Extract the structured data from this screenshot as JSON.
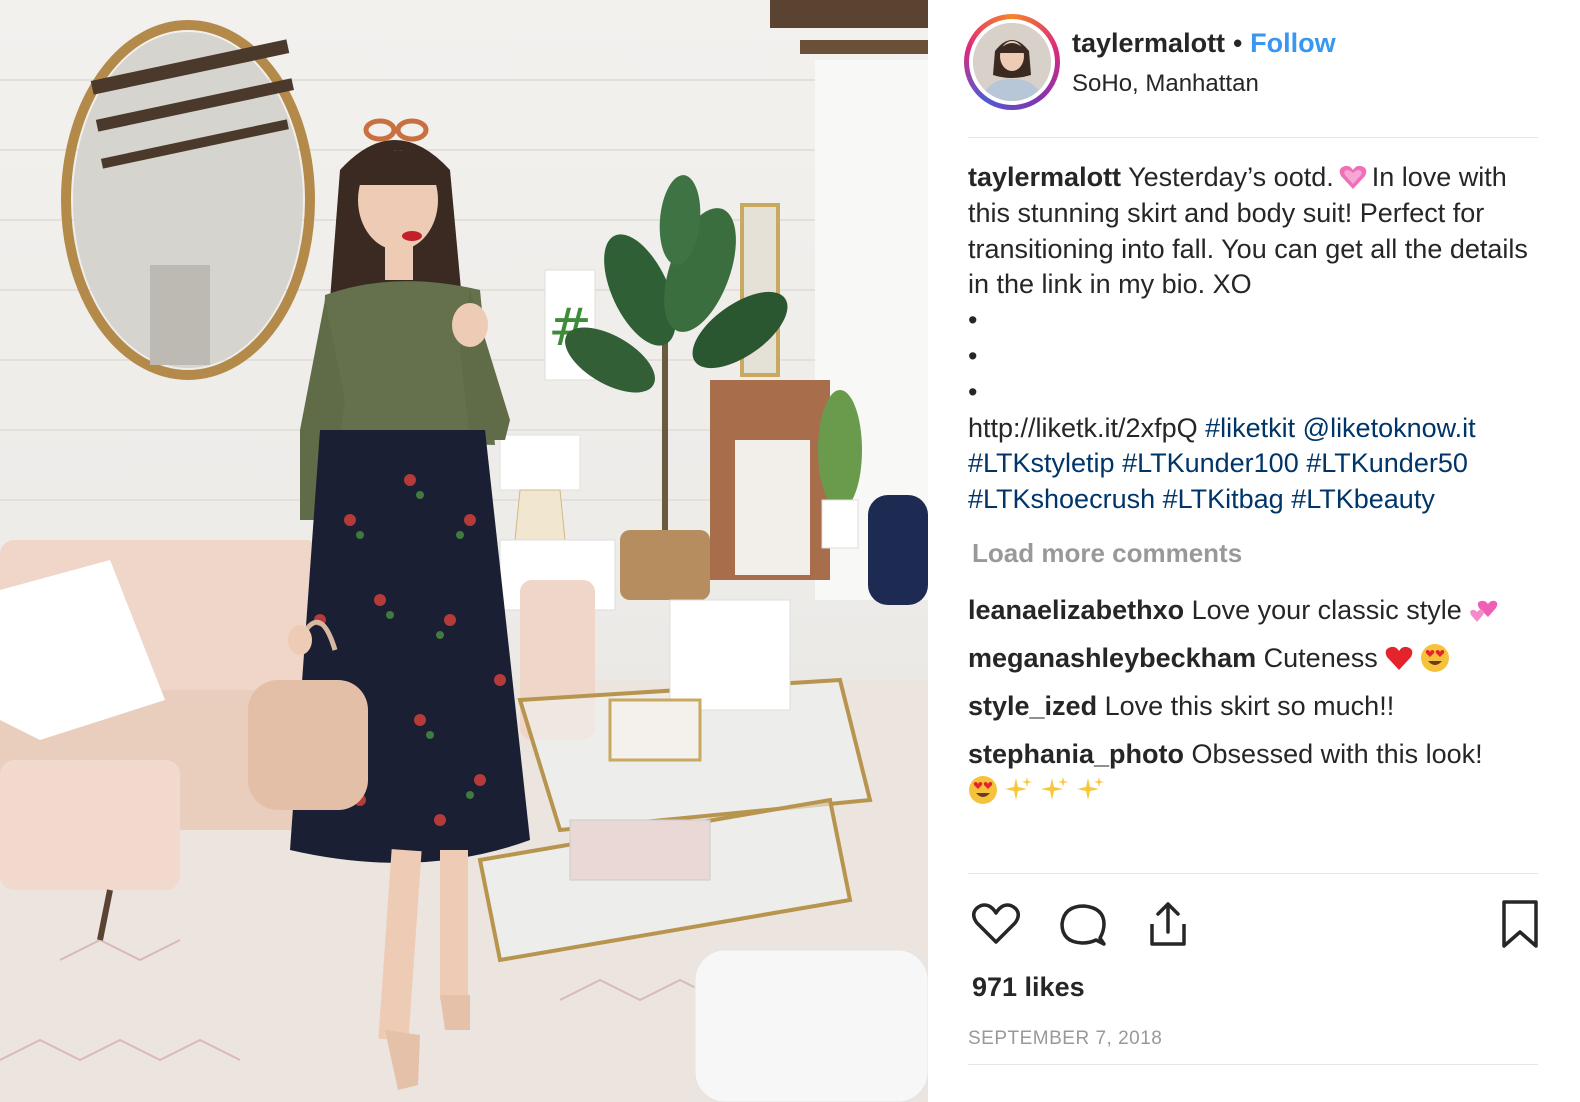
{
  "post": {
    "username": "taylermalott",
    "dot": "•",
    "follow_label": "Follow",
    "location": "SoHo, Manhattan",
    "caption": {
      "username": "taylermalott",
      "text_1": "Yesterday’s ootd.",
      "text_2": "In love with this stunning skirt and body suit! Perfect for transitioning into fall. You can get all the details in the link in my bio. XO",
      "bullet": "•",
      "link": "http://liketk.it/2xfpQ",
      "tags_line_1": [
        "#liketkit",
        "@liketoknow.it"
      ],
      "tags_line_2": [
        "#LTKstyletip",
        "#LTKunder100",
        "#LTKunder50"
      ],
      "tags_line_3": [
        "#LTKshoecrush",
        "#LTKitbag",
        "#LTKbeauty"
      ]
    },
    "load_more_label": "Load more comments",
    "comments": [
      {
        "username": "leanaelizabethxo",
        "text": "Love your classic style",
        "emoji": [
          "two-hearts-icon"
        ]
      },
      {
        "username": "meganashleybeckham",
        "text": "Cuteness",
        "emoji": [
          "red-heart-icon",
          "heart-eyes-icon"
        ]
      },
      {
        "username": "style_ized",
        "text": "Love this skirt so much!!",
        "emoji": []
      },
      {
        "username": "stephania_photo",
        "text": "Obsessed with this look!",
        "emoji": [
          "heart-eyes-icon",
          "sparkles-icon",
          "sparkles-icon",
          "sparkles-icon"
        ]
      }
    ],
    "likes_label": "971 likes",
    "date_label": "SEPTEMBER 7, 2018",
    "colors": {
      "follow": "#3897f0",
      "hashtag": "#003569",
      "muted": "#999999",
      "text": "#262626"
    }
  }
}
